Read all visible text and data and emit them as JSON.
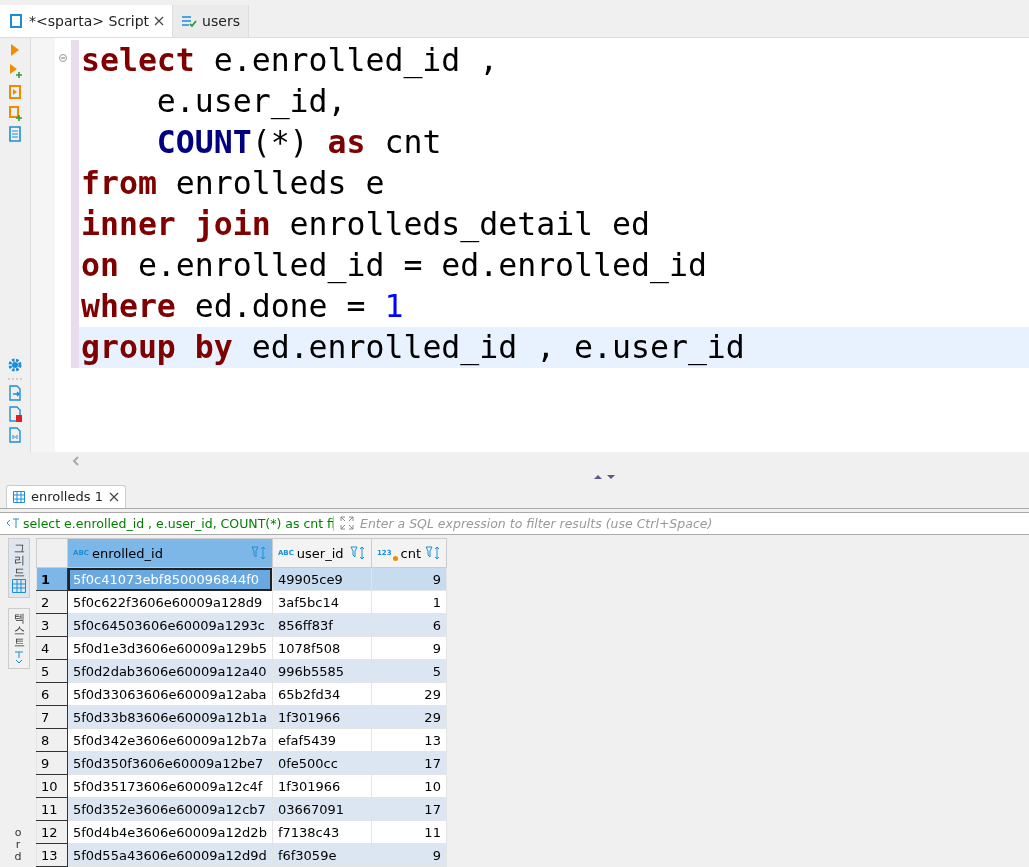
{
  "editor_tabs": [
    {
      "label": "*<sparta> Script",
      "selected": true,
      "kind": "script"
    },
    {
      "label": "users",
      "selected": false,
      "kind": "table"
    }
  ],
  "editor": {
    "lines": [
      {
        "current": false,
        "tokens": [
          {
            "kind": "keyword",
            "text": "select"
          },
          {
            "kind": "plain",
            "text": " e.enrolled_id ,"
          }
        ]
      },
      {
        "current": false,
        "tokens": [
          {
            "kind": "plain",
            "text": "    e.user_id,"
          }
        ]
      },
      {
        "current": false,
        "tokens": [
          {
            "kind": "function",
            "text": "    COUNT"
          },
          {
            "kind": "plain",
            "text": "(*) "
          },
          {
            "kind": "keyword",
            "text": "as"
          },
          {
            "kind": "plain",
            "text": " cnt"
          }
        ]
      },
      {
        "current": false,
        "tokens": [
          {
            "kind": "keyword",
            "text": "from"
          },
          {
            "kind": "plain",
            "text": " enrolleds e"
          }
        ]
      },
      {
        "current": false,
        "tokens": [
          {
            "kind": "keyword",
            "text": "inner"
          },
          {
            "kind": "keyword",
            "text": " join"
          },
          {
            "kind": "plain",
            "text": " enrolleds_detail ed"
          }
        ]
      },
      {
        "current": false,
        "tokens": [
          {
            "kind": "keyword",
            "text": "on"
          },
          {
            "kind": "plain",
            "text": " e.enrolled_id = ed.enrolled_id"
          }
        ]
      },
      {
        "current": false,
        "tokens": [
          {
            "kind": "keyword",
            "text": "where"
          },
          {
            "kind": "plain",
            "text": " ed.done = "
          },
          {
            "kind": "number",
            "text": "1"
          }
        ]
      },
      {
        "current": true,
        "tokens": [
          {
            "kind": "keyword",
            "text": "group"
          },
          {
            "kind": "keyword",
            "text": " by"
          },
          {
            "kind": "plain",
            "text": " ed.enrolled_id , e.user_id"
          }
        ]
      }
    ]
  },
  "results_tabs": [
    {
      "label": "enrolleds 1",
      "selected": true
    }
  ],
  "filter": {
    "query": "select e.enrolled_id , e.user_id, COUNT(*) as cnt fi",
    "placeholder": "Enter a SQL expression to filter results (use Ctrl+Space)"
  },
  "side_tabs": [
    {
      "label": "그리드",
      "selected": true,
      "kind": "grid"
    },
    {
      "label": "텍스트",
      "selected": false,
      "kind": "text"
    },
    {
      "label": "ord",
      "selected": false,
      "kind": "plain"
    }
  ],
  "table": {
    "columns": [
      {
        "label": "enrolled_id",
        "type_label": "ABC",
        "kind": "text",
        "selected": true
      },
      {
        "label": "user_id",
        "type_label": "ABC",
        "kind": "text",
        "selected": false
      },
      {
        "label": "cnt",
        "type_label": "123",
        "kind": "number",
        "selected": false
      }
    ],
    "rows": [
      {
        "number": "1",
        "selected": true,
        "cells": [
          "5f0c41073ebf8500096844f0",
          "49905ce9",
          "9"
        ]
      },
      {
        "number": "2",
        "selected": false,
        "cells": [
          "5f0c622f3606e60009a128d9",
          "3af5bc14",
          "1"
        ]
      },
      {
        "number": "3",
        "selected": false,
        "cells": [
          "5f0c64503606e60009a1293c",
          "856ff83f",
          "6"
        ]
      },
      {
        "number": "4",
        "selected": false,
        "cells": [
          "5f0d1e3d3606e60009a129b5",
          "1078f508",
          "9"
        ]
      },
      {
        "number": "5",
        "selected": false,
        "cells": [
          "5f0d2dab3606e60009a12a40",
          "996b5585",
          "5"
        ]
      },
      {
        "number": "6",
        "selected": false,
        "cells": [
          "5f0d33063606e60009a12aba",
          "65b2fd34",
          "29"
        ]
      },
      {
        "number": "7",
        "selected": false,
        "cells": [
          "5f0d33b83606e60009a12b1a",
          "1f301966",
          "29"
        ]
      },
      {
        "number": "8",
        "selected": false,
        "cells": [
          "5f0d342e3606e60009a12b7a",
          "efaf5439",
          "13"
        ]
      },
      {
        "number": "9",
        "selected": false,
        "cells": [
          "5f0d350f3606e60009a12be7",
          "0fe500cc",
          "17"
        ]
      },
      {
        "number": "10",
        "selected": false,
        "cells": [
          "5f0d35173606e60009a12c4f",
          "1f301966",
          "10"
        ]
      },
      {
        "number": "11",
        "selected": false,
        "cells": [
          "5f0d352e3606e60009a12cb7",
          "03667091",
          "17"
        ]
      },
      {
        "number": "12",
        "selected": false,
        "cells": [
          "5f0d4b4e3606e60009a12d2b",
          "f7138c43",
          "11"
        ]
      },
      {
        "number": "13",
        "selected": false,
        "cells": [
          "5f0d55a43606e60009a12d9d",
          "f6f3059e",
          "9"
        ]
      }
    ]
  }
}
